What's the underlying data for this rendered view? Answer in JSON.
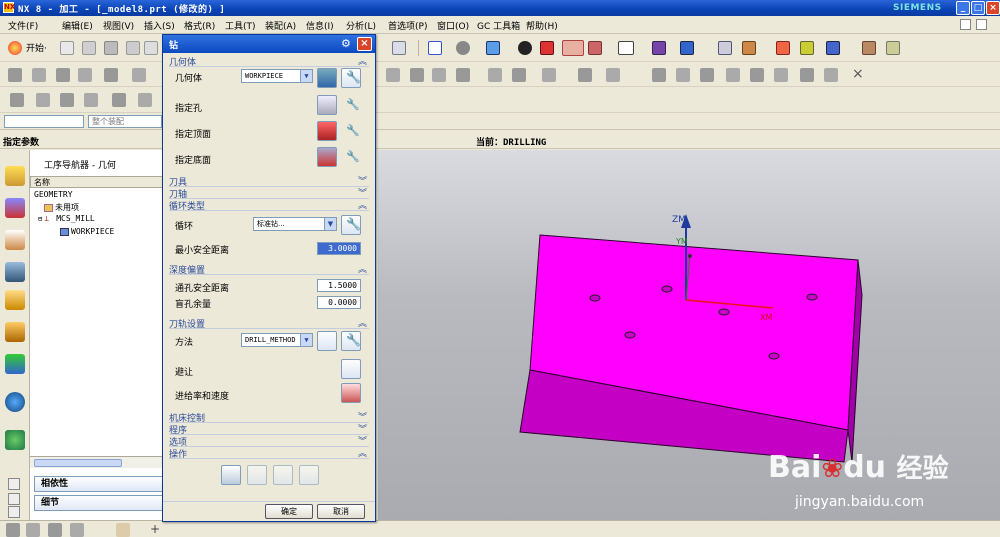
{
  "window": {
    "title": "NX 8 - 加工 - [_model8.prt  (修改的)  ]",
    "brand": "SIEMENS",
    "app_icon_label": "NX"
  },
  "menu": {
    "items": [
      "文件(F)",
      "编辑(E)",
      "视图(V)",
      "插入(S)",
      "格式(R)",
      "工具(T)",
      "装配(A)",
      "信息(I)",
      "分析(L)",
      "首选项(P)",
      "窗口(O)",
      "GC 工具箱",
      "帮助(H)"
    ]
  },
  "toolbar": {
    "start_label": "开始·"
  },
  "combos": {
    "filter": "",
    "assembly_scope": "整个装配"
  },
  "status": {
    "left_label": "指定参数",
    "current_label": "当前：DRILLING"
  },
  "navigator": {
    "title": "工序导航器 - 几何",
    "column_name": "名称",
    "tree": [
      {
        "label": "GEOMETRY",
        "level": 0
      },
      {
        "label": "未用项",
        "level": 1
      },
      {
        "label": "MCS_MILL",
        "level": 1
      },
      {
        "label": "WORKPIECE",
        "level": 2
      }
    ],
    "panels": [
      "相依性",
      "细节"
    ]
  },
  "dialog": {
    "title": "钻",
    "sections": {
      "geometry": "几何体",
      "tool": "刀具",
      "axis": "刀轴",
      "cycle_type": "循环类型",
      "depth_offset": "深度偏置",
      "path_settings": "刀轨设置",
      "machine_control": "机床控制",
      "program": "程序",
      "options": "选项",
      "actions": "操作"
    },
    "geometry_label": "几何体",
    "geometry_value": "WORKPIECE",
    "specify_hole": "指定孔",
    "specify_top": "指定顶面",
    "specify_bottom": "指定底面",
    "cycle_label": "循环",
    "cycle_value": "标准钻...",
    "min_clearance_label": "最小安全距离",
    "min_clearance_value": "3.0000",
    "through_clearance_label": "通孔安全距离",
    "through_clearance_value": "1.5000",
    "blind_stock_label": "盲孔余量",
    "blind_stock_value": "0.0000",
    "method_label": "方法",
    "method_value": "DRILL_METHOD",
    "avoid_label": "避让",
    "feeds_label": "进给率和速度",
    "ok_label": "确定",
    "cancel_label": "取消"
  },
  "viewport": {
    "axis_z": "ZM",
    "axis_y": "YM",
    "axis_x": "XM",
    "part_color": "#ff00ff",
    "part_side_color": "#b000b8",
    "part_front_color": "#d800d8"
  },
  "watermark": {
    "brand": "Bai",
    "brand2": "du",
    "cn": "经验",
    "url": "jingyan.baidu.com"
  }
}
